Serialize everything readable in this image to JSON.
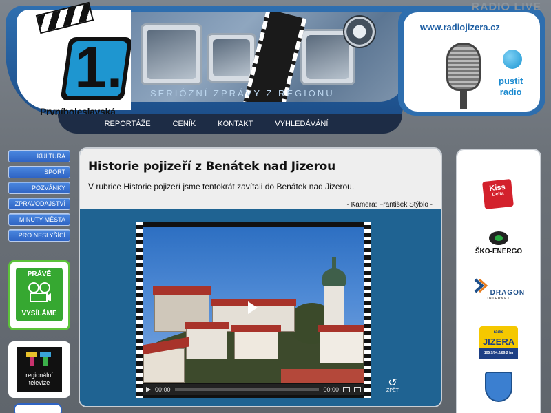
{
  "header": {
    "logo_name": "Prvníboleslavská",
    "logo_number": "1.",
    "tagline": "SERIÓZNÍ ZPRÁVY Z REGIONU",
    "radio": {
      "live_label": "RADIO LIVE",
      "url": "www.radiojizera.cz",
      "play_line1": "pustit",
      "play_line2": "radio"
    },
    "nav": [
      "REPORTÁŽE",
      "CENÍK",
      "KONTAKT",
      "VYHLEDÁVÁNÍ"
    ]
  },
  "sidebar": {
    "menu": [
      "KULTURA",
      "SPORT",
      "POZVÁNKY",
      "ZPRAVODAJSTVÍ",
      "MINUTY MĚSTA",
      "PRO NESLYŠÍCÍ"
    ],
    "onair_line1": "PRÁVĚ",
    "onair_line2": "VYSÍLÁME",
    "regional_line1": "regionální",
    "regional_line2": "televize"
  },
  "article": {
    "title": "Historie pojizeří z Benátek nad Jizerou",
    "description": "V rubrice Historie pojizeří jsme tentokrát zavítali do Benátek nad Jizerou.",
    "credit": "- Kamera: František Stýblo -"
  },
  "player": {
    "time_current": "00:00",
    "time_total": "00:00",
    "back_label": "ZPĚT"
  },
  "sponsors": {
    "kiss_name": "Kiss",
    "kiss_sub": "Delta",
    "sko_name": "ŠKO-ENERGO",
    "dragon_name": "DRAGON",
    "dragon_sub": "INTERNET",
    "jizera_top": "rádio",
    "jizera_name": "JIZERA",
    "jizera_freq": "105,7/94,2/89,2 fm"
  },
  "colors": {
    "header_blue": "#2f6fb0",
    "nav_dark": "#1d2c45",
    "menu_blue": "#2f64c4",
    "onair_green": "#36a831",
    "video_blue": "#1f6392"
  }
}
